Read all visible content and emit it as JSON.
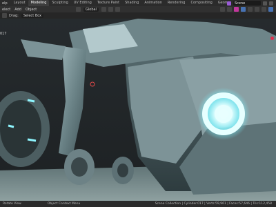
{
  "topbar": {
    "menus": [
      "elp",
      "Layout",
      "Modeling",
      "Sculpting",
      "UV Editing",
      "Texture Paint",
      "Shading",
      "Animation",
      "Rendering",
      "Compositing",
      "Geometry Nod"
    ],
    "active_index": 2,
    "scene_label": "Scene"
  },
  "header2": {
    "items": [
      "elect",
      "Add",
      "Object"
    ],
    "orientation": "Global"
  },
  "header3": {
    "items": [
      "Drag:",
      "Select Box"
    ]
  },
  "viewport": {
    "frame_label": "017"
  },
  "statusbar": {
    "left1": "Rotate View",
    "left2": "Object Context Menu",
    "right": "Scene Collection | Cylinder.017 | Verts:59,961 | Faces:57,646 | Tris:112,458"
  },
  "colors": {
    "accent_blue": "#4772b3",
    "glow": "#7ff4ff",
    "active_tab": "#3d3d3d"
  }
}
